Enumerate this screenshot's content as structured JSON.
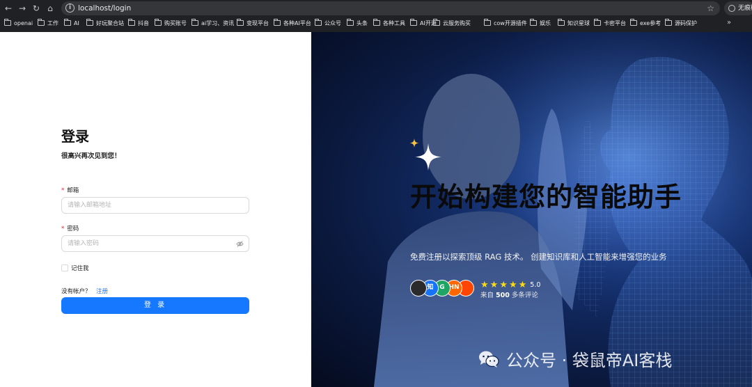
{
  "browser": {
    "url": "localhost/login",
    "profile_label": "无痕模式",
    "more_bookmarks": "»",
    "bookmarks": [
      {
        "label": "openai"
      },
      {
        "label": "工作"
      },
      {
        "label": "AI"
      },
      {
        "label": "好玩聚合站"
      },
      {
        "label": "抖音"
      },
      {
        "label": "购买账号"
      },
      {
        "label": "ai学习、资讯"
      },
      {
        "label": "变现平台"
      },
      {
        "label": "各种AI平台"
      },
      {
        "label": "公众号"
      },
      {
        "label": "头条"
      },
      {
        "label": "各种工具"
      },
      {
        "label": "AI开源"
      },
      {
        "label": "云服务购买"
      },
      {
        "label": "cow开源插件"
      },
      {
        "label": "娱乐"
      },
      {
        "label": "知识星球"
      },
      {
        "label": "卡密平台"
      },
      {
        "label": "exe参考"
      },
      {
        "label": "源码保护"
      }
    ]
  },
  "login": {
    "title": "登录",
    "subtitle": "很高兴再次见到您！",
    "email_label": "邮箱",
    "email_placeholder": "请输入邮箱地址",
    "password_label": "密码",
    "password_placeholder": "请输入密码",
    "remember_label": "记住我",
    "no_account": "没有帐户？",
    "register_link": "注册",
    "submit_label": "登 录",
    "required_mark": "*"
  },
  "hero": {
    "headline": "开始构建您的智能助手",
    "description": "免费注册以探索顶级 RAG 技术。 创建知识库和人工智能来增强您的业务",
    "rating": "5.0",
    "reviews_prefix": "来自 ",
    "reviews_count": "500",
    "reviews_suffix": " 多条评论",
    "avatars": [
      {
        "label": "",
        "color": "#2b2b2b"
      },
      {
        "label": "知",
        "color": "#1772f6"
      },
      {
        "label": "G",
        "color": "#1fa463"
      },
      {
        "label": "HN",
        "color": "#ff6600"
      },
      {
        "label": "",
        "color": "#ff4500"
      }
    ],
    "watermark": "公众号 · 袋鼠帝AI客栈"
  },
  "colors": {
    "primary": "#1677ff",
    "required": "#f5222d",
    "star": "#fadb14"
  }
}
